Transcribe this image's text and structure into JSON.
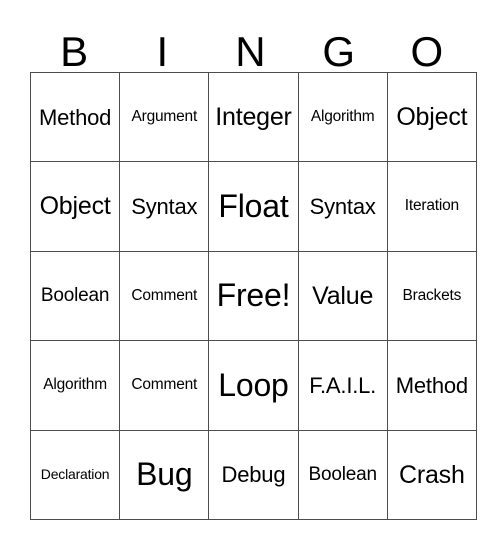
{
  "card": {
    "title": "BINGO",
    "header_letters": [
      "B",
      "I",
      "N",
      "G",
      "O"
    ],
    "free_space_label": "Free!",
    "grid": {
      "rows": 5,
      "columns": 5,
      "cells": [
        [
          {
            "text": "Method",
            "size": "fs-l"
          },
          {
            "text": "Argument",
            "size": "fs-s"
          },
          {
            "text": "Integer",
            "size": "fs-xl"
          },
          {
            "text": "Algorithm",
            "size": "fs-s"
          },
          {
            "text": "Object",
            "size": "fs-xl"
          }
        ],
        [
          {
            "text": "Object",
            "size": "fs-xl"
          },
          {
            "text": "Syntax",
            "size": "fs-l"
          },
          {
            "text": "Float",
            "size": "fs-xxl"
          },
          {
            "text": "Syntax",
            "size": "fs-l"
          },
          {
            "text": "Iteration",
            "size": "fs-s"
          }
        ],
        [
          {
            "text": "Boolean",
            "size": "fs-m"
          },
          {
            "text": "Comment",
            "size": "fs-s"
          },
          {
            "text": "Free!",
            "size": "fs-xxl"
          },
          {
            "text": "Value",
            "size": "fs-xl"
          },
          {
            "text": "Brackets",
            "size": "fs-s"
          }
        ],
        [
          {
            "text": "Algorithm",
            "size": "fs-s"
          },
          {
            "text": "Comment",
            "size": "fs-s"
          },
          {
            "text": "Loop",
            "size": "fs-xxl"
          },
          {
            "text": "F.A.I.L.",
            "size": "fs-l"
          },
          {
            "text": "Method",
            "size": "fs-l"
          }
        ],
        [
          {
            "text": "Declaration",
            "size": "fs-xs"
          },
          {
            "text": "Bug",
            "size": "fs-xxl"
          },
          {
            "text": "Debug",
            "size": "fs-l"
          },
          {
            "text": "Boolean",
            "size": "fs-m"
          },
          {
            "text": "Crash",
            "size": "fs-xl"
          }
        ]
      ]
    },
    "colors": {
      "background": "#ffffff",
      "text": "#000000",
      "grid_line": "#4d4d4d"
    }
  }
}
